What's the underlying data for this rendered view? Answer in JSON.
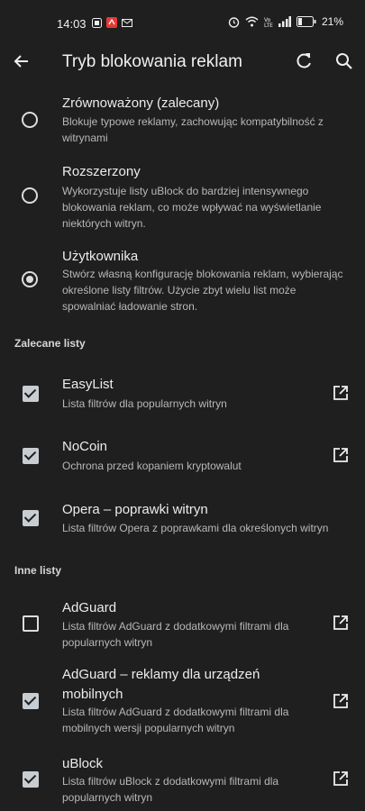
{
  "status": {
    "time": "14:03",
    "battery": "21%",
    "icons": [
      "app-notif-icon",
      "pdf-notif-icon",
      "mail-notif-icon",
      "alarm-icon",
      "wifi-icon",
      "volte-icon",
      "signal-icon",
      "battery-icon"
    ]
  },
  "appbar": {
    "title": "Tryb blokowania reklam",
    "icons": [
      "back-arrow-icon",
      "refresh-icon",
      "search-icon"
    ]
  },
  "modes": [
    {
      "title": "Zrównoważony (zalecany)",
      "desc": "Blokuje typowe reklamy, zachowując kompatybilność z witrynami",
      "selected": false
    },
    {
      "title": "Rozszerzony",
      "desc": "Wykorzystuje listy uBlock do bardziej intensywnego blokowania reklam, co może wpływać na wyświetlanie niektórych witryn.",
      "selected": false
    },
    {
      "title": "Użytkownika",
      "desc": "Stwórz własną konfigurację blokowania reklam, wybierając określone listy filtrów. Użycie zbyt wielu list może spowalniać ładowanie stron.",
      "selected": true
    }
  ],
  "recommended": {
    "header": "Zalecane listy",
    "items": [
      {
        "title": "EasyList",
        "desc": "Lista filtrów dla popularnych witryn",
        "checked": true,
        "external": true
      },
      {
        "title": "NoCoin",
        "desc": "Ochrona przed kopaniem kryptowalut",
        "checked": true,
        "external": true
      },
      {
        "title": "Opera – poprawki witryn",
        "desc": "Lista filtrów Opera z poprawkami dla określonych witryn",
        "checked": true,
        "external": false
      }
    ]
  },
  "other": {
    "header": "Inne listy",
    "items": [
      {
        "title": "AdGuard",
        "desc": "Lista filtrów AdGuard z dodatkowymi filtrami dla popularnych witryn",
        "checked": false,
        "external": true
      },
      {
        "title": "AdGuard – reklamy dla urządzeń mobilnych",
        "desc": "Lista filtrów AdGuard z dodatkowymi filtrami dla mobilnych wersji popularnych witryn",
        "checked": true,
        "external": true
      },
      {
        "title": "uBlock",
        "desc": "Lista filtrów uBlock z dodatkowymi filtrami dla popularnych witryn",
        "checked": true,
        "external": true
      }
    ]
  },
  "colors": {
    "background": "#1f1f1f",
    "text": "#ececec",
    "secondary": "#b8b8b8",
    "checkbox": "#c8cdd2"
  }
}
